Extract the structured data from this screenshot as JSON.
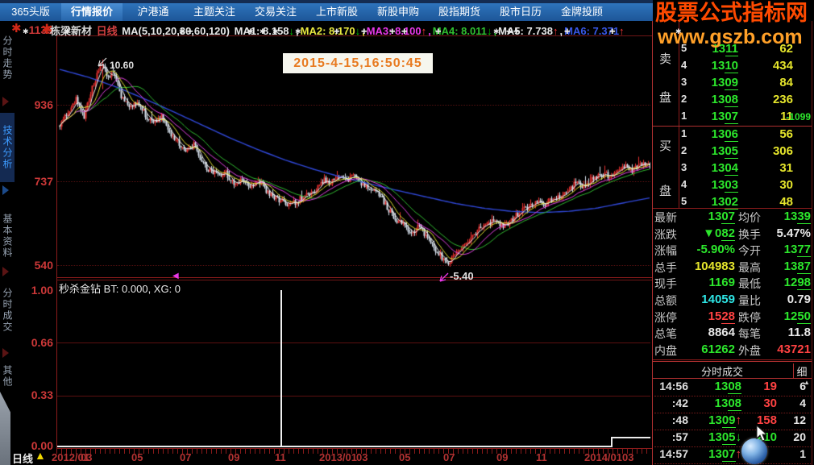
{
  "menu": {
    "tabs": [
      "365头版",
      "行情报价",
      "沪港通",
      "主题关注",
      "交易关注",
      "上市新股",
      "新股申购",
      "股指期货",
      "股市日历",
      "金牌投顾"
    ],
    "active_tab": "行情报价"
  },
  "watermark": {
    "line1": "股票公式指标网",
    "line2": "www.gszb.com"
  },
  "chart_header": {
    "stock_name": "栋梁新材",
    "period": "日线",
    "ma_group": "MA(5,10,20,30,60,120)",
    "mas": [
      {
        "label": "MA1:",
        "value": "8.158",
        "arrow": "↓",
        "color": "#e8e8e8",
        "arrow_color": "#00c800"
      },
      {
        "label": "MA2:",
        "value": "8.170",
        "arrow": "↓",
        "color": "#e8e840",
        "arrow_color": "#00c800"
      },
      {
        "label": "MA3:",
        "value": "8.100",
        "arrow": "↑",
        "color": "#e838e8",
        "arrow_color": "#ff3838"
      },
      {
        "label": "MA4:",
        "value": "8.011",
        "arrow": "↓",
        "color": "#30c030",
        "arrow_color": "#00c800"
      },
      {
        "label": "MA5:",
        "value": "7.738",
        "arrow": "↑",
        "color": "#e8e8e8",
        "arrow_color": "#ff3838"
      },
      {
        "label": "MA6:",
        "value": "7.371",
        "arrow": "↑",
        "color": "#3858e8",
        "arrow_color": "#ff3838"
      }
    ]
  },
  "sidebar": {
    "items": [
      "分时走势",
      "技术分析",
      "基本资料",
      "分时成交",
      "其他"
    ],
    "active_index": 1
  },
  "main_chart": {
    "y_ticks": [
      "1135",
      "936",
      "737",
      "540"
    ],
    "high_annotation": "10.60",
    "low_annotation": "-5.40",
    "timestamp_annotation": "2015-4-15,16:50:45"
  },
  "sub_chart": {
    "label": "秒杀金钻",
    "params": "BT: 0.000, XG: 0",
    "y_ticks": [
      "1.00",
      "0.66",
      "0.33",
      "0.00"
    ]
  },
  "x_axis": {
    "labels": [
      "2012/01",
      "03",
      "05",
      "07",
      "09",
      "11",
      "2013/01",
      "03",
      "05",
      "07",
      "09",
      "11",
      "2014/01",
      "03"
    ],
    "period_label": "日线"
  },
  "order_book": {
    "sell_label": "卖盘",
    "buy_label": "买盘",
    "sell_rows": [
      {
        "n": "5",
        "m": "13",
        "u": "11",
        "vol": "62"
      },
      {
        "n": "4",
        "m": "13",
        "u": "10",
        "vol": "434"
      },
      {
        "n": "3",
        "m": "13",
        "u": "09",
        "vol": "84"
      },
      {
        "n": "2",
        "m": "13",
        "u": "08",
        "vol": "236"
      },
      {
        "n": "1",
        "m": "13",
        "u": "07",
        "vol": "11",
        "extra": "-1099"
      }
    ],
    "buy_rows": [
      {
        "n": "1",
        "m": "13",
        "u": "06",
        "vol": "56"
      },
      {
        "n": "2",
        "m": "13",
        "u": "05",
        "vol": "306"
      },
      {
        "n": "3",
        "m": "13",
        "u": "04",
        "vol": "31"
      },
      {
        "n": "4",
        "m": "13",
        "u": "03",
        "vol": "30"
      },
      {
        "n": "5",
        "m": "13",
        "u": "02",
        "vol": "48"
      }
    ]
  },
  "quote": {
    "rows": [
      {
        "l1": "最新",
        "m1": "13",
        "u1": "07",
        "c1": "green",
        "l2": "均价",
        "m2": "13",
        "u2": "39",
        "c2": "green"
      },
      {
        "l1": "涨跌",
        "m1": "▼0",
        "u1": "82",
        "c1": "green",
        "l2": "换手",
        "m2": "5.47%",
        "u2": "",
        "c2": "white"
      },
      {
        "l1": "涨幅",
        "m1": "-5.90%",
        "u1": "",
        "c1": "green",
        "l2": "今开",
        "m2": "13",
        "u2": "77",
        "c2": "green"
      },
      {
        "l1": "总手",
        "m1": "104983",
        "u1": "",
        "c1": "yellow",
        "l2": "最高",
        "m2": "13",
        "u2": "87",
        "c2": "green"
      },
      {
        "l1": "现手",
        "m1": "1169",
        "u1": "",
        "c1": "green",
        "l2": "最低",
        "m2": "12",
        "u2": "98",
        "c2": "green"
      },
      {
        "l1": "总额",
        "m1": "14059",
        "u1": "",
        "c1": "cyan",
        "l2": "量比",
        "m2": "0.79",
        "u2": "",
        "c2": "white"
      },
      {
        "l1": "涨停",
        "m1": "15",
        "u1": "28",
        "c1": "red",
        "l2": "跌停",
        "m2": "12",
        "u2": "50",
        "c2": "green"
      },
      {
        "l1": "总笔",
        "m1": "8864",
        "u1": "",
        "c1": "white",
        "l2": "每笔",
        "m2": "11.8",
        "u2": "",
        "c2": "white"
      },
      {
        "l1": "内盘",
        "m1": "61262",
        "u1": "",
        "c1": "green",
        "l2": "外盘",
        "m2": "43721",
        "u2": "",
        "c2": "red"
      }
    ]
  },
  "tick_panel": {
    "title": "分时成交",
    "detail_button": "细",
    "rows": [
      {
        "time": "14:56",
        "m": "13",
        "u": "08",
        "arrow": "",
        "vol": "19",
        "vc": "red",
        "n": "6"
      },
      {
        "time": ":42",
        "m": "13",
        "u": "08",
        "arrow": "",
        "vol": "30",
        "vc": "red",
        "n": "4"
      },
      {
        "time": ":48",
        "m": "13",
        "u": "09",
        "arrow": "up",
        "vol": "158",
        "vc": "red",
        "n": "12"
      },
      {
        "time": ":57",
        "m": "13",
        "u": "05",
        "arrow": "down",
        "vol": "210",
        "vc": "green",
        "n": "20"
      },
      {
        "time": "14:57",
        "m": "13",
        "u": "07",
        "arrow": "up",
        "vol": "",
        "vc": "red",
        "n": "1"
      }
    ]
  },
  "chart_data": {
    "type": "candlestick",
    "y_axis_values": [
      1135,
      936,
      737,
      540
    ],
    "sub_y_values": [
      1.0,
      0.66,
      0.33,
      0.0
    ],
    "price_anchors": [
      [
        74,
        895
      ],
      [
        84,
        925
      ],
      [
        94,
        958
      ],
      [
        104,
        918
      ],
      [
        114,
        988
      ],
      [
        124,
        1040
      ],
      [
        127,
        1058
      ],
      [
        132,
        1012
      ],
      [
        139,
        1030
      ],
      [
        150,
        968
      ],
      [
        160,
        940
      ],
      [
        170,
        955
      ],
      [
        180,
        920
      ],
      [
        190,
        900
      ],
      [
        200,
        915
      ],
      [
        210,
        878
      ],
      [
        220,
        850
      ],
      [
        230,
        830
      ],
      [
        240,
        845
      ],
      [
        250,
        800
      ],
      [
        260,
        780
      ],
      [
        270,
        765
      ],
      [
        280,
        772
      ],
      [
        290,
        745
      ],
      [
        300,
        752
      ],
      [
        310,
        742
      ],
      [
        320,
        756
      ],
      [
        330,
        728
      ],
      [
        340,
        712
      ],
      [
        350,
        700
      ],
      [
        360,
        692
      ],
      [
        370,
        705
      ],
      [
        380,
        716
      ],
      [
        390,
        728
      ],
      [
        400,
        755
      ],
      [
        410,
        748
      ],
      [
        420,
        768
      ],
      [
        430,
        758
      ],
      [
        440,
        762
      ],
      [
        450,
        742
      ],
      [
        460,
        732
      ],
      [
        470,
        718
      ],
      [
        480,
        685
      ],
      [
        490,
        658
      ],
      [
        500,
        642
      ],
      [
        510,
        622
      ],
      [
        520,
        640
      ],
      [
        530,
        608
      ],
      [
        540,
        580
      ],
      [
        550,
        556
      ],
      [
        558,
        545
      ],
      [
        565,
        572
      ],
      [
        575,
        592
      ],
      [
        585,
        612
      ],
      [
        595,
        632
      ],
      [
        605,
        645
      ],
      [
        615,
        652
      ],
      [
        625,
        638
      ],
      [
        635,
        658
      ],
      [
        645,
        672
      ],
      [
        655,
        688
      ],
      [
        665,
        698
      ],
      [
        675,
        694
      ],
      [
        685,
        708
      ],
      [
        695,
        718
      ],
      [
        705,
        732
      ],
      [
        715,
        748
      ],
      [
        725,
        738
      ],
      [
        735,
        758
      ],
      [
        745,
        772
      ],
      [
        755,
        766
      ],
      [
        765,
        782
      ],
      [
        775,
        792
      ],
      [
        785,
        778
      ],
      [
        795,
        798
      ],
      [
        806,
        792
      ]
    ],
    "ma120_anchors": [
      [
        74,
        1035
      ],
      [
        110,
        1015
      ],
      [
        145,
        990
      ],
      [
        180,
        960
      ],
      [
        215,
        928
      ],
      [
        250,
        895
      ],
      [
        285,
        862
      ],
      [
        320,
        832
      ],
      [
        355,
        805
      ],
      [
        390,
        782
      ],
      [
        425,
        762
      ],
      [
        460,
        745
      ],
      [
        495,
        728
      ],
      [
        530,
        712
      ],
      [
        565,
        696
      ],
      [
        600,
        684
      ],
      [
        635,
        676
      ],
      [
        670,
        673
      ],
      [
        705,
        676
      ],
      [
        740,
        684
      ],
      [
        770,
        696
      ],
      [
        806,
        710
      ]
    ],
    "sub_spike_x": 349,
    "high_point": {
      "x": 127,
      "price": 1060,
      "label": "10.60"
    },
    "low_point": {
      "x": 552,
      "price": 540,
      "label": "-5.40"
    },
    "ma_colors": {
      "ma5": "#f0f0f0",
      "ma10": "#e0e030",
      "ma20": "#e040e0",
      "ma30": "#30b830",
      "ma120": "#3048d8"
    },
    "candle_up_color": "#e83030",
    "candle_down_color": "#d8e2ee"
  }
}
